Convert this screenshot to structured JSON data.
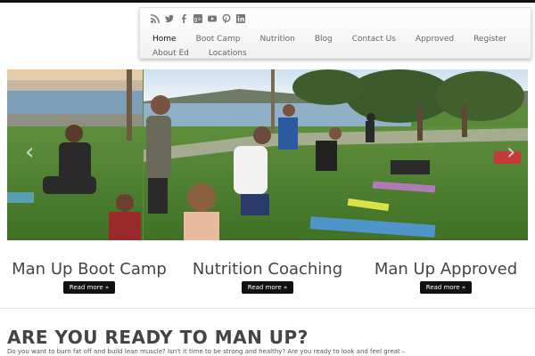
{
  "social_icons": [
    "rss-icon",
    "twitter-icon",
    "facebook-icon",
    "google-plus-icon",
    "youtube-icon",
    "pinterest-icon",
    "linkedin-icon"
  ],
  "nav": {
    "items": [
      "Home",
      "Boot Camp",
      "Nutrition",
      "Blog",
      "Contact Us",
      "Approved",
      "Register",
      "About Ed",
      "Locations"
    ],
    "active": "Home"
  },
  "slider": {
    "prev_glyph": "‹",
    "next_glyph": "›"
  },
  "features": [
    {
      "title": "Man Up Boot Camp",
      "button": "Read more »"
    },
    {
      "title": "Nutrition Coaching",
      "button": "Read more »"
    },
    {
      "title": "Man Up Approved",
      "button": "Read more »"
    }
  ],
  "headline": "ARE YOU READY TO MAN UP?",
  "intro": "Do you want to burn fat off and build lean muscle? Isn't it time to be strong and healthy? Are you ready to look and feel great –",
  "colors": {
    "button_bg": "#111111",
    "button_text": "#ffffff",
    "top_bar": "#111111"
  }
}
